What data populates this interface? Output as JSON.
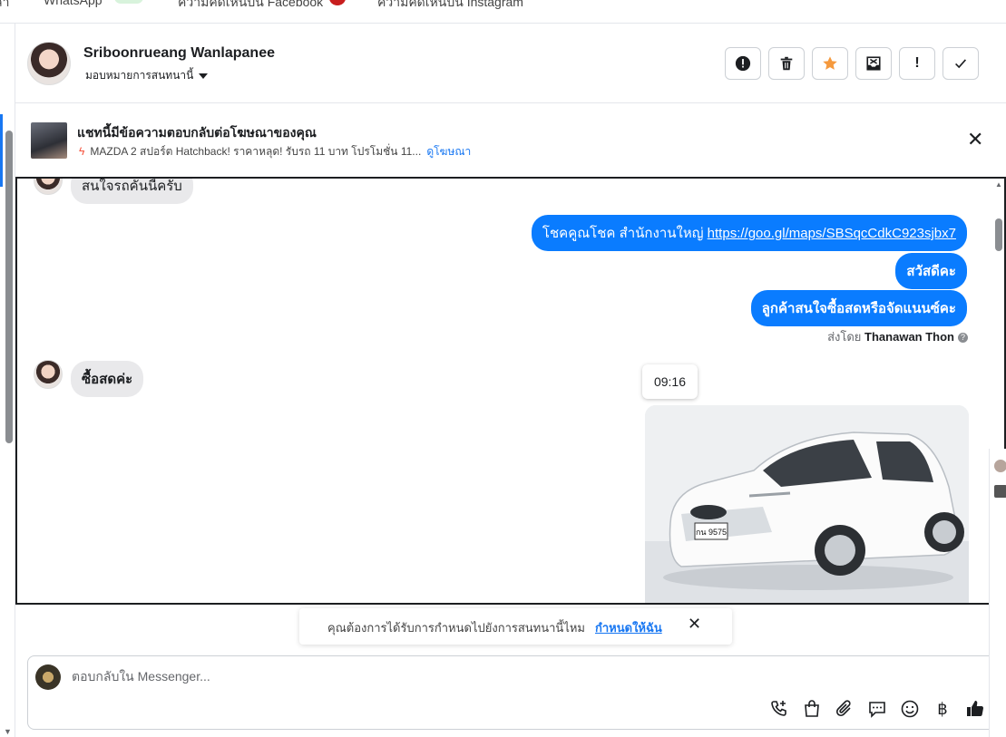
{
  "topbar": {
    "tabs": [
      "ลา",
      "WhatsApp",
      "ความคิดเห็นบน Facebook",
      "ความคิดเห็นบน Instagram"
    ]
  },
  "header": {
    "contact_name": "Sriboonrueang Wanlapanee",
    "assign_label": "มอบหมายการสนทนานี้",
    "buttons": [
      {
        "name": "spam",
        "icon": "alert-circle-icon"
      },
      {
        "name": "delete",
        "icon": "trash-icon"
      },
      {
        "name": "star",
        "icon": "star-icon"
      },
      {
        "name": "archive",
        "icon": "inbox-move-icon"
      },
      {
        "name": "follow-up",
        "icon": "exclamation-icon"
      },
      {
        "name": "done",
        "icon": "check-icon"
      }
    ],
    "star_color": "#f5993d"
  },
  "ad_banner": {
    "title": "แชทนี้มีข้อความตอบกลับต่อโฆษณาของคุณ",
    "ad_text": "MAZDA 2 สปอร์ต Hatchback! ราคาหลุด! รับรถ 11 บาท โปรโมชั่น 11...",
    "view_ad": "ดูโฆษณา"
  },
  "messages": {
    "incoming_1": "สนใจรถคันนี้ครับ",
    "outgoing_1_text": "โชคคูณโชค สำนักงานใหญ่",
    "outgoing_1_link": "https://goo.gl/maps/SBSqcCdkC923sjbx7",
    "outgoing_2": "สวัสดีคะ",
    "outgoing_3": "ลูกค้าสนใจซื้อสดหรือจัดแนนซ์คะ",
    "sent_by_label": "ส่งโดย",
    "sent_by_name": "Thanawan Thon",
    "incoming_2": "ซื้อสดค่ะ",
    "time_tooltip": "09:16",
    "car_plate": "กน 9575"
  },
  "assign_toast": {
    "text": "คุณต้องการได้รับการกำหนดไปยังการสนทนานี้ไหม",
    "link": "กำหนดให้ฉัน"
  },
  "composer": {
    "placeholder": "ตอบกลับใน Messenger...",
    "tools": [
      "call-add-icon",
      "shopping-bag-icon",
      "attachment-icon",
      "saved-reply-icon",
      "emoji-icon",
      "baht-icon",
      "thumbs-up-icon"
    ]
  },
  "colors": {
    "accent": "#0a7cff",
    "link": "#1877f2"
  }
}
